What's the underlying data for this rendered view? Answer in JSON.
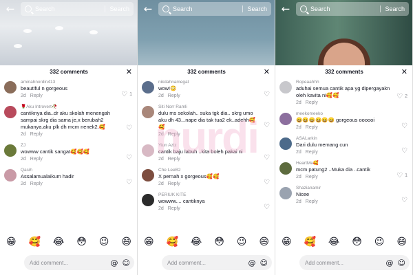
{
  "watermark": "nurdi",
  "search": {
    "placeholder": "Search",
    "button": "Search"
  },
  "emojis": [
    "😁",
    "🥰",
    "😂",
    "😳",
    "😉",
    "😄"
  ],
  "input": {
    "placeholder": "Add comment..."
  },
  "panels": [
    {
      "count": "332 comments",
      "comments": [
        {
          "user": "aminahnordin413",
          "text": "beautiful n gorgeous",
          "time": "2d",
          "reply": "Reply",
          "likes": "1",
          "color": "#8a6d5a"
        },
        {
          "user": "🌹Aku Introvert🥀",
          "text": "cantiknya dia..dr aku skolah menengah sampai skrg dia sama je,x berubah2 mukanya.aku plk dh mcm nenek2.🥰",
          "time": "2d",
          "reply": "Reply",
          "likes": "",
          "color": "#b84a5c"
        },
        {
          "user": "ZJ",
          "text": "wowww cantik sangat🥰🥰🥰",
          "time": "2d",
          "reply": "Reply",
          "likes": "",
          "color": "#6b7a3a"
        },
        {
          "user": "Qasih",
          "text": "Assalamualaikum hadir",
          "time": "2d",
          "reply": "Reply",
          "likes": "",
          "color": "#c99aa6"
        }
      ]
    },
    {
      "count": "332 comments",
      "comments": [
        {
          "user": "nikdahnamegat",
          "text": "wow!😳",
          "time": "2d",
          "reply": "Reply",
          "likes": "",
          "color": "#5b6e8c"
        },
        {
          "user": "Siti Norr Ramli",
          "text": "dulu ms sekolah.. suka tgk dia.. skrg umo aku dh 43...nape dia tak tua2 ek..adehh🥰🥰",
          "time": "2d",
          "reply": "Reply",
          "likes": "",
          "color": "#a9877a"
        },
        {
          "user": "Yiun Aziz",
          "text": "cantik baju labuh ..kita boleh pakai ni",
          "time": "2d",
          "reply": "Reply",
          "likes": "",
          "color": "#d8b9c4"
        },
        {
          "user": "Che LeeB2",
          "text": "X pernah x gorgeous🥰🥰",
          "time": "2d",
          "reply": "Reply",
          "likes": "",
          "color": "#7d4d3f"
        },
        {
          "user": "PERIUK KITE",
          "text": "wowww.... cantiknya",
          "time": "2d",
          "reply": "Reply",
          "likes": "",
          "color": "#2b2b2b"
        }
      ]
    },
    {
      "count": "332 comments",
      "comments": [
        {
          "user": "Ropeaahhh",
          "text": "aduhai semua cantik apa yg dipergayakn oleh kavita ni🥰🥰",
          "time": "2d",
          "reply": "Reply",
          "likes": "2",
          "color": "#c8c8cc"
        },
        {
          "user": "meekomeeko",
          "text": "😄😄😄😄😄😄 gorgeous oooooi",
          "time": "2d",
          "reply": "Reply",
          "likes": "",
          "color": "#8c6f9e"
        },
        {
          "user": "ASALarkin",
          "text": "Dari dulu memang cun",
          "time": "2d",
          "reply": "Reply",
          "likes": "",
          "color": "#4c6a8a"
        },
        {
          "user": "HeartMe🥰",
          "text": "mcm patung2 ..Muka dia ..cantik",
          "time": "2d",
          "reply": "Reply",
          "likes": "1",
          "color": "#5d6b3e"
        },
        {
          "user": "Shazianamir",
          "text": "Nicee",
          "time": "2d",
          "reply": "Reply",
          "likes": "",
          "color": "#9aa3b0"
        }
      ]
    }
  ]
}
